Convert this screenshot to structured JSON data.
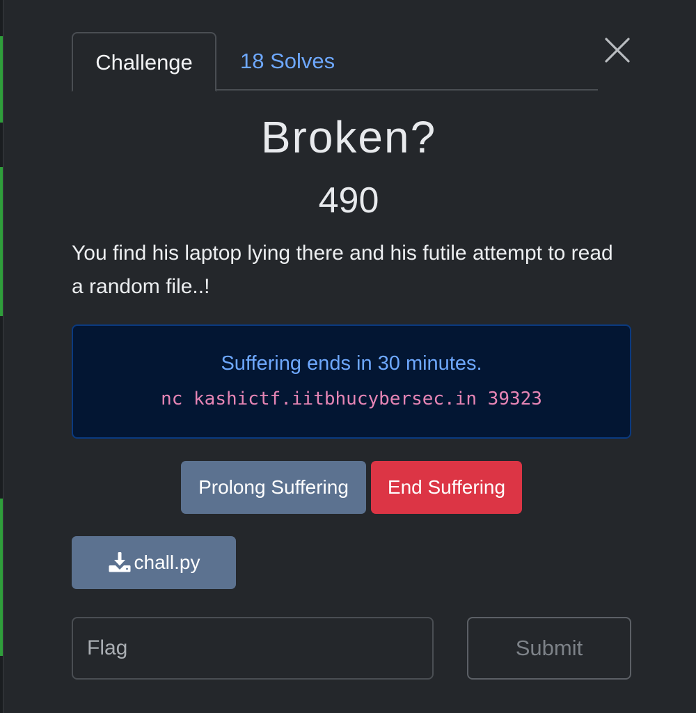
{
  "tabs": {
    "challenge_label": "Challenge",
    "solves_label": "18 Solves"
  },
  "challenge": {
    "title": "Broken?",
    "points": "490",
    "description": "You find his laptop lying there and his futile attempt to read a random file..!"
  },
  "instance": {
    "status_text": "Suffering ends in 30 minutes.",
    "connection_command": "nc kashictf.iitbhucybersec.in 39323"
  },
  "buttons": {
    "prolong_label": "Prolong Suffering",
    "end_label": "End Suffering",
    "file_label": "chall.py",
    "submit_label": "Submit"
  },
  "flag_input": {
    "placeholder": "Flag",
    "value": ""
  },
  "icons": {
    "close": "close-icon",
    "download": "download-icon"
  },
  "colors": {
    "modal_bg": "#24272b",
    "tab_link": "#6ea8fe",
    "alert_bg": "#031633",
    "alert_text": "#6ea8fe",
    "code_text": "#e685b5",
    "secondary_button": "#5c7290",
    "danger_button": "#dc3545"
  }
}
